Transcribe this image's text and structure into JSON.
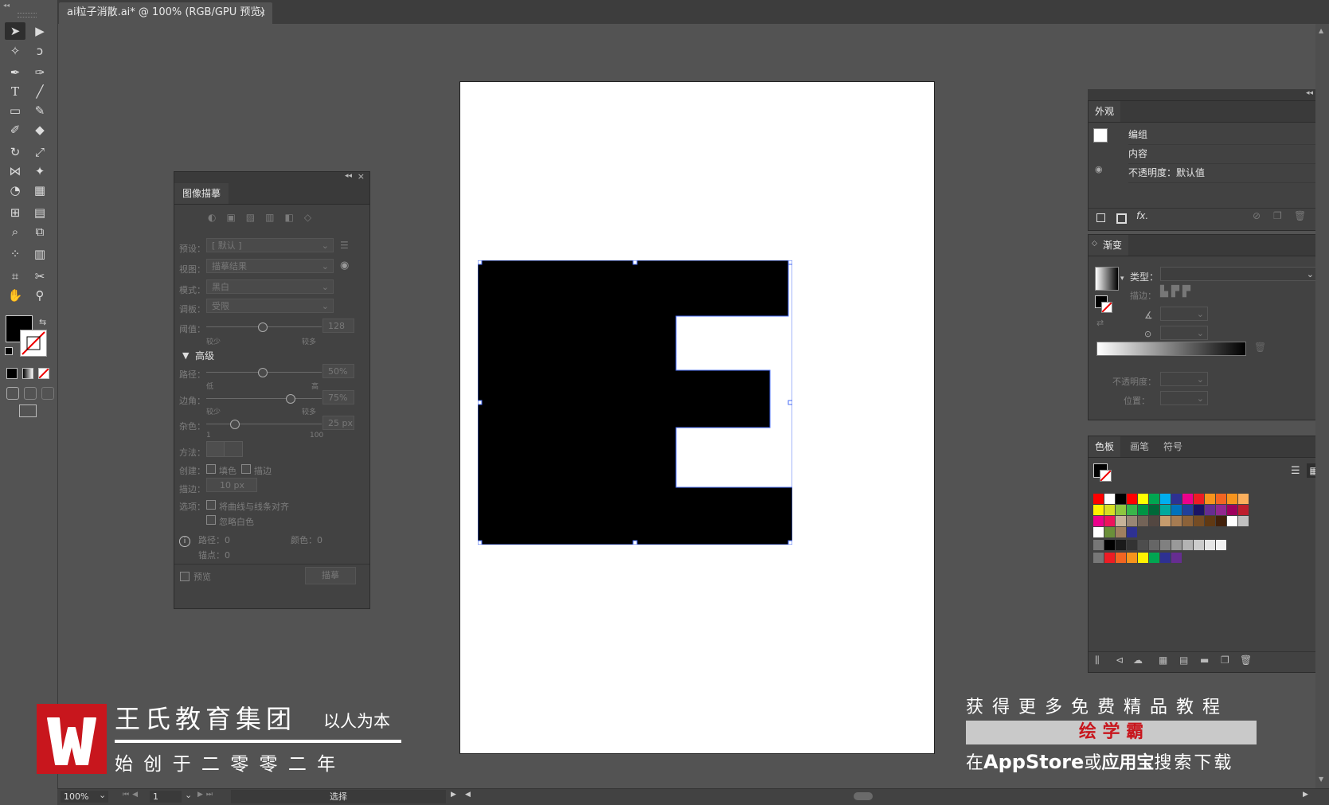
{
  "window": {
    "doc_tab_title": "ai粒子消散.ai* @ 100% (RGB/GPU 预览)",
    "doc_tab_close": "×"
  },
  "trace_panel": {
    "title": "图像描摹",
    "preset_label": "预设：",
    "preset_value": "[ 默认 ]",
    "view_label": "视图：",
    "view_value": "描摹结果",
    "mode_label": "模式：",
    "mode_value": "黑白",
    "palette_label": "调板：",
    "palette_value": "受限",
    "threshold_label": "阈值：",
    "threshold_value": "128",
    "threshold_min": "较少",
    "threshold_max": "较多",
    "threshold_level": 0.5,
    "advanced_label": "高级",
    "paths_label": "路径：",
    "paths_value": "50%",
    "paths_min": "低",
    "paths_max": "高",
    "paths_level": 0.5,
    "corners_label": "边角：",
    "corners_value": "75%",
    "corners_min": "较少",
    "corners_max": "较多",
    "corners_level": 0.75,
    "noise_label": "杂色：",
    "noise_value": "25 px",
    "noise_min": "1",
    "noise_max": "100",
    "noise_level": 0.25,
    "method_label": "方法：",
    "create_label": "创建：",
    "create_fill": "填色",
    "create_stroke": "描边",
    "stroke_label": "描边：",
    "stroke_value": "10 px",
    "options_label": "选项：",
    "option_snap": "将曲线与线条对齐",
    "option_ignore_white": "忽略白色",
    "info_paths": "路径：0",
    "info_colors": "颜色：0",
    "info_anchors": "锚点：0",
    "preview_label": "预览",
    "trace_button": "描摹"
  },
  "appearance_panel": {
    "title": "外观",
    "row_group": "编组",
    "row_contents": "内容",
    "row_opacity": "不透明度：默认值"
  },
  "gradient_panel": {
    "title": "渐变",
    "type_label": "类型：",
    "stroke_label": "描边：",
    "opacity_label": "不透明度：",
    "location_label": "位置："
  },
  "swatches_panel": {
    "tab_swatches": "色板",
    "tab_brushes": "画笔",
    "tab_symbols": "符号",
    "row1": [
      "#ff0000",
      "#ffffff",
      "#000000",
      "#ff0000",
      "#ffff00",
      "#00a651",
      "#00aeef",
      "#2e3192",
      "#ec008c",
      "#ed1c24",
      "#f7941d",
      "#f26522",
      "#f7941d",
      "#fbaf5d"
    ],
    "row2": [
      "#fff200",
      "#d7df23",
      "#8dc63f",
      "#39b54a",
      "#009444",
      "#006838",
      "#00a99d",
      "#0072bc",
      "#21409a",
      "#1b1464",
      "#662d91",
      "#92278f",
      "#9e005d",
      "#be1e2d"
    ],
    "row3": [
      "#ec008c",
      "#ed145b",
      "#c7b299",
      "#998675",
      "#736357",
      "#534741",
      "#c69c6d",
      "#a67c52",
      "#8c6239",
      "#754c24",
      "#603913",
      "#42210b",
      "#ffffff",
      "#c0c0c0"
    ],
    "row5": [
      "#000000",
      "#1a1a1a",
      "#333333",
      "#4d4d4d",
      "#666666",
      "#808080",
      "#999999",
      "#b3b3b3",
      "#cccccc",
      "#e6e6e6",
      "#f2f2f2"
    ],
    "row6": [
      "#ed1c24",
      "#f26522",
      "#f7941d",
      "#fff200",
      "#00a651",
      "#2e3192",
      "#662d91"
    ]
  },
  "statusbar": {
    "zoom": "100%",
    "page": "1",
    "tool_status": "选择"
  },
  "overlay": {
    "brand_name": "王氏教育集团",
    "brand_slogan": "以人为本",
    "brand_founded": "始 创 于 二 零 零 二 年",
    "promo_line1": "获 得 更 多 免 费 精 品 教 程",
    "promo_box": "绘 学 霸",
    "promo_line3_a": "在",
    "promo_line3_b": "AppStore",
    "promo_line3_c": "或",
    "promo_line3_d": "应用宝",
    "promo_line3_e": "搜索下载"
  },
  "colors": {
    "brand_red": "#c8161d",
    "promo_red": "#c8161d",
    "selection_blue": "#4a6ef5"
  }
}
